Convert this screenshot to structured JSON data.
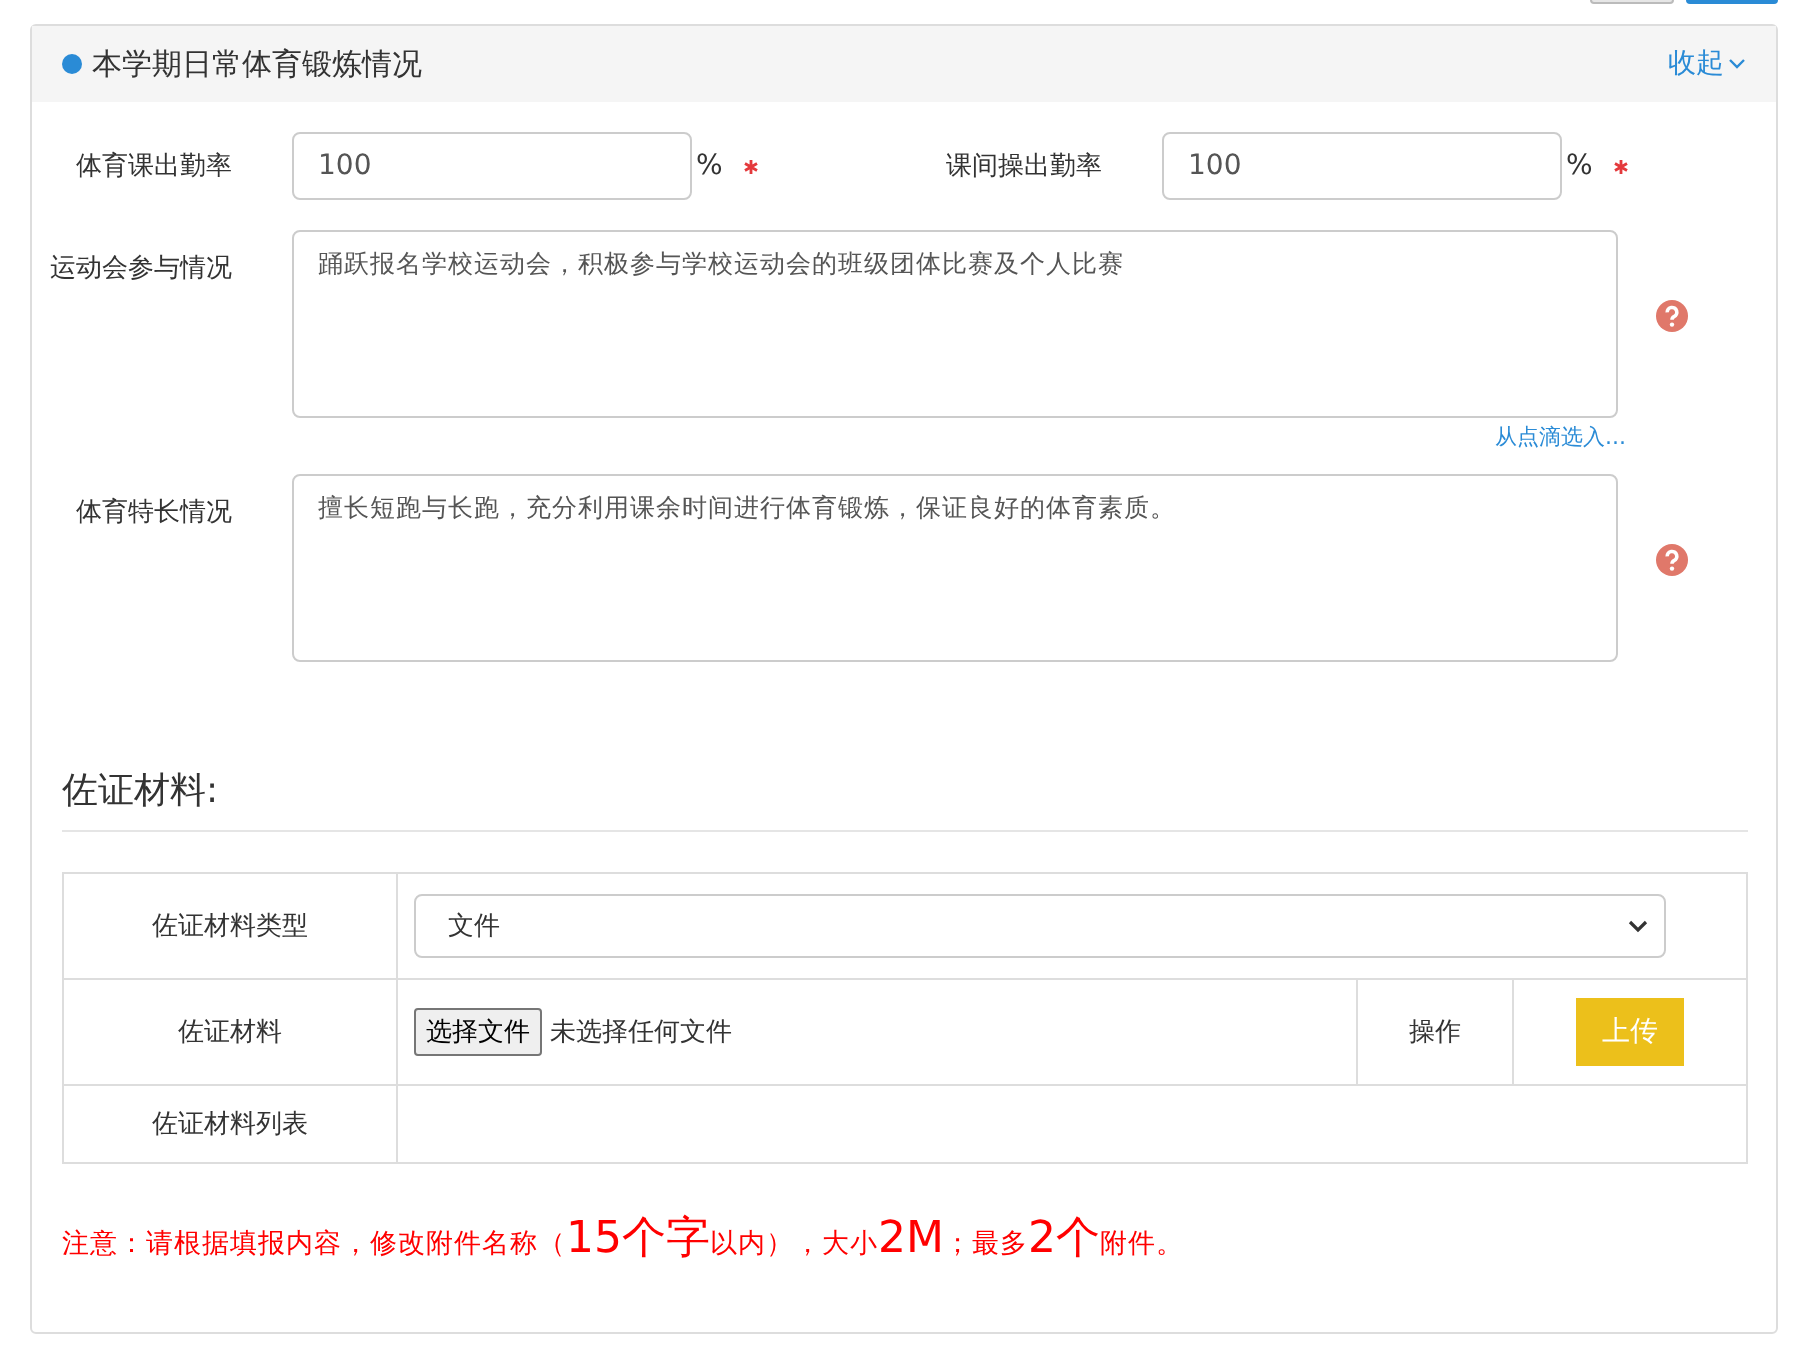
{
  "panel": {
    "title": "本学期日常体育锻炼情况",
    "collapse": "收起"
  },
  "rates": [
    {
      "label": "体育课出勤率",
      "value": "100",
      "unit": "%",
      "required": true
    },
    {
      "label": "课间操出勤率",
      "value": "100",
      "unit": "%",
      "required": true
    }
  ],
  "areas": [
    {
      "label": "运动会参与情况",
      "value": "踊跃报名学校运动会，积极参与学校运动会的班级团体比赛及个人比赛",
      "link": "从点滴选入..."
    },
    {
      "label": "体育特长情况",
      "value": "擅长短跑与长跑，充分利用课余时间进行体育锻炼，保证良好的体育素质。"
    }
  ],
  "evidence": {
    "heading": "佐证材料:",
    "type_label": "佐证材料类型",
    "type_value": "文件",
    "file_label": "佐证材料",
    "file_button": "选择文件",
    "file_status": "未选择任何文件",
    "op_label": "操作",
    "upload": "上传",
    "list_label": "佐证材料列表"
  },
  "note": [
    {
      "text": "注意：请根据填报内容，修改附件名称（",
      "kind": "normal"
    },
    {
      "text": "15个字",
      "kind": "large"
    },
    {
      "text": "以内），大小",
      "kind": "normal"
    },
    {
      "text": "2M",
      "kind": "large"
    },
    {
      "text": "；最多",
      "kind": "normal"
    },
    {
      "text": "2个",
      "kind": "large"
    },
    {
      "text": "附件。",
      "kind": "normal"
    }
  ]
}
